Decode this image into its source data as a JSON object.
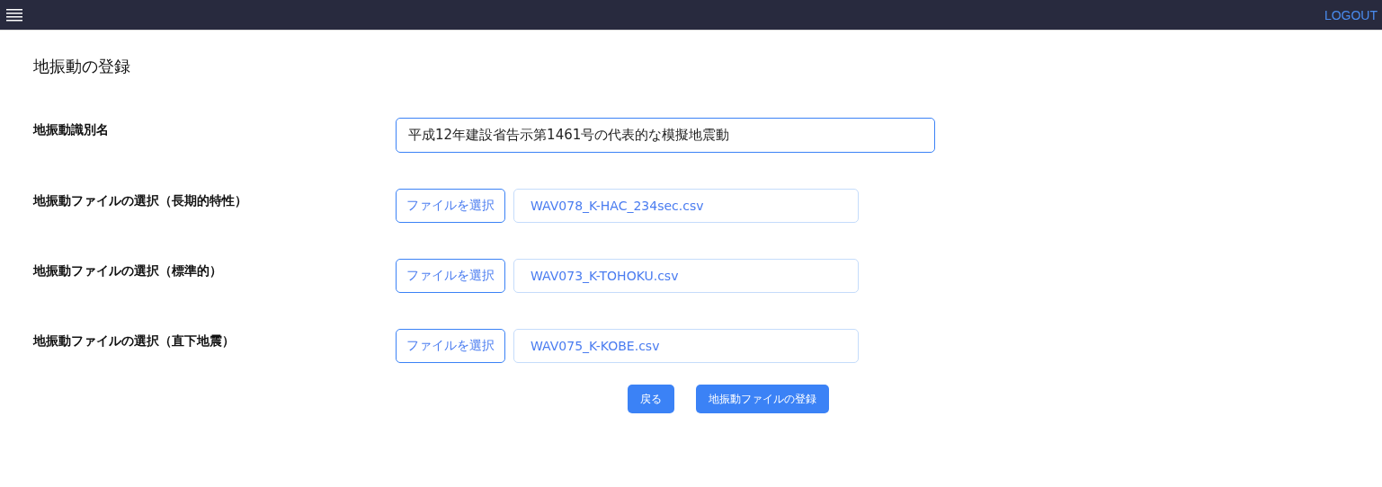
{
  "header": {
    "logout": "LOGOUT"
  },
  "page_title": "地振動の登録",
  "name_field": {
    "label": "地振動識別名",
    "value": "平成12年建設省告示第1461号の代表的な模擬地震動"
  },
  "file_rows": [
    {
      "label": "地振動ファイルの選択（長期的特性）",
      "button": "ファイルを選択",
      "file": "WAV078_K-HAC_234sec.csv"
    },
    {
      "label": "地振動ファイルの選択（標準的）",
      "button": "ファイルを選択",
      "file": "WAV073_K-TOHOKU.csv"
    },
    {
      "label": "地振動ファイルの選択（直下地震）",
      "button": "ファイルを選択",
      "file": "WAV075_K-KOBE.csv"
    }
  ],
  "buttons": {
    "back": "戻る",
    "submit": "地振動ファイルの登録"
  }
}
